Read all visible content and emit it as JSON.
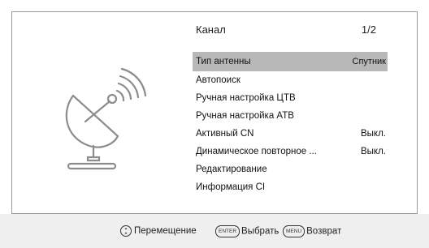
{
  "header": {
    "title": "Канал",
    "page": "1/2"
  },
  "menu": [
    {
      "label": "Тип антенны",
      "value": "Спутник",
      "selected": true
    },
    {
      "label": "Автопоиск",
      "value": ""
    },
    {
      "label": "Ручная настройка ЦТВ",
      "value": ""
    },
    {
      "label": "Ручная настройка АТВ",
      "value": ""
    },
    {
      "label": "Активный CN",
      "value": "Выкл."
    },
    {
      "label": "Динамическое повторное ...",
      "value": "Выкл."
    },
    {
      "label": "Редактирование",
      "value": ""
    },
    {
      "label": "Информация CI",
      "value": ""
    }
  ],
  "footer": {
    "move_label": "Перемещение",
    "enter_key": "ENTER",
    "select_label": "Выбрать",
    "menu_key": "MENU",
    "back_label": "Возврат"
  },
  "icons": {
    "illustration": "satellite-dish-icon",
    "navigation": "dpad-icon"
  },
  "colors": {
    "selection": "#b8b8b8",
    "footer_bg": "#efefef",
    "text": "#111111"
  }
}
